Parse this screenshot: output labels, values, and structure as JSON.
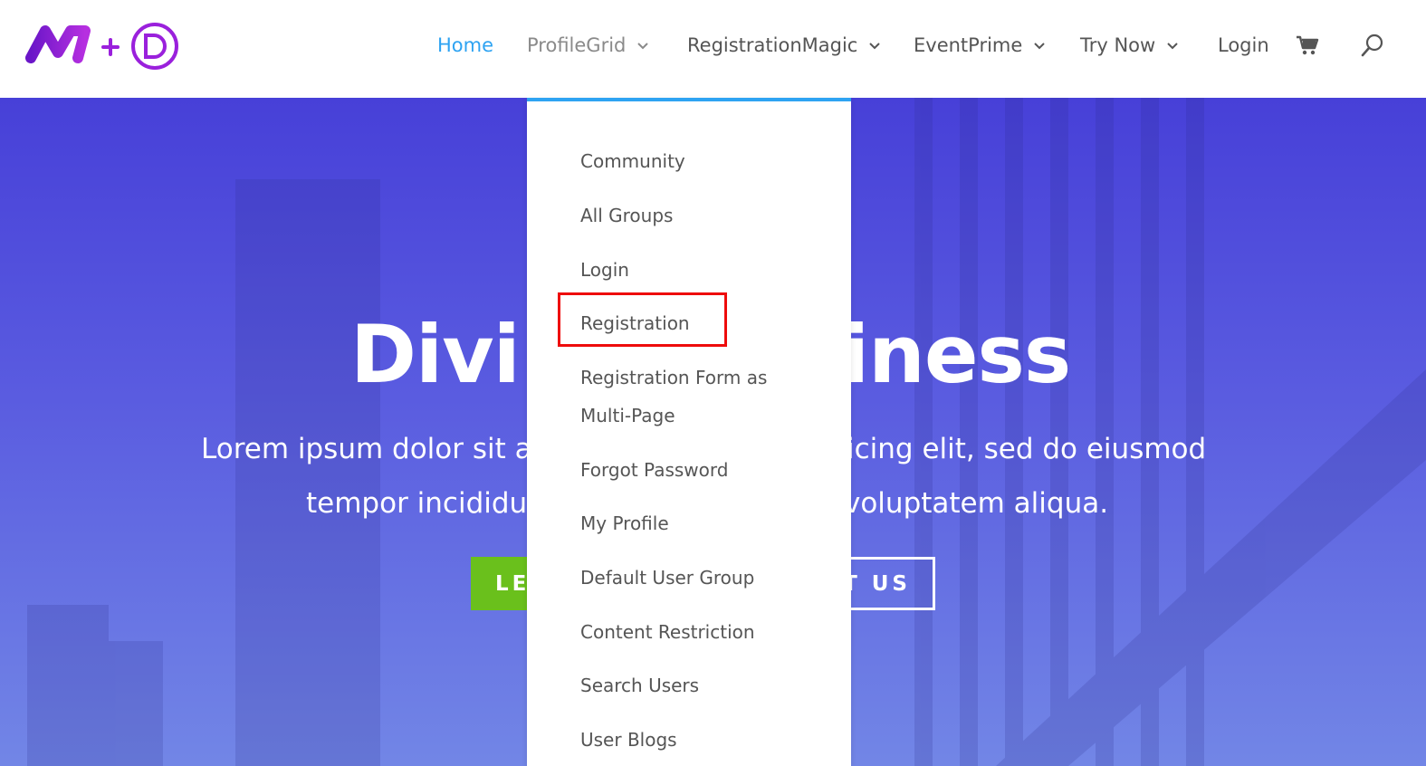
{
  "header": {
    "logo": {
      "left_mark": "M",
      "plus": "+",
      "right_mark": "D"
    },
    "nav": [
      {
        "label": "Home",
        "state": "active"
      },
      {
        "label": "ProfileGrid",
        "state": "open",
        "has_dropdown": true
      },
      {
        "label": "RegistrationMagic",
        "has_dropdown": true
      },
      {
        "label": "EventPrime",
        "has_dropdown": true
      },
      {
        "label": "Try Now",
        "has_dropdown": true
      },
      {
        "label": "Login"
      }
    ],
    "icons": {
      "cart": "shopping-cart-icon",
      "search": "search-icon"
    }
  },
  "hero": {
    "title_left": "Divi",
    "title_right": "iness",
    "subtitle_line1_left": "Lorem ipsum dolor sit a",
    "subtitle_line1_right": "icing elit, sed do eiusmod",
    "subtitle_line2_left": "tempor incididu",
    "subtitle_line2_right": "voluptatem aliqua.",
    "button_left": "LE",
    "button_right": "T US"
  },
  "dropdown": {
    "items": [
      "Community",
      "All Groups",
      "Login",
      "Registration",
      "Registration Form as Multi-Page",
      "Forgot Password",
      "My Profile",
      "Default User Group",
      "Content Restriction",
      "Search Users",
      "User Blogs"
    ],
    "highlighted": "Registration"
  },
  "colors": {
    "accent": "#2ea3f2",
    "logo_purple": "#8a1bd6",
    "highlight": "#ee0c0c",
    "button_green": "#6ac01c",
    "hero_blue": "#4740d8"
  }
}
